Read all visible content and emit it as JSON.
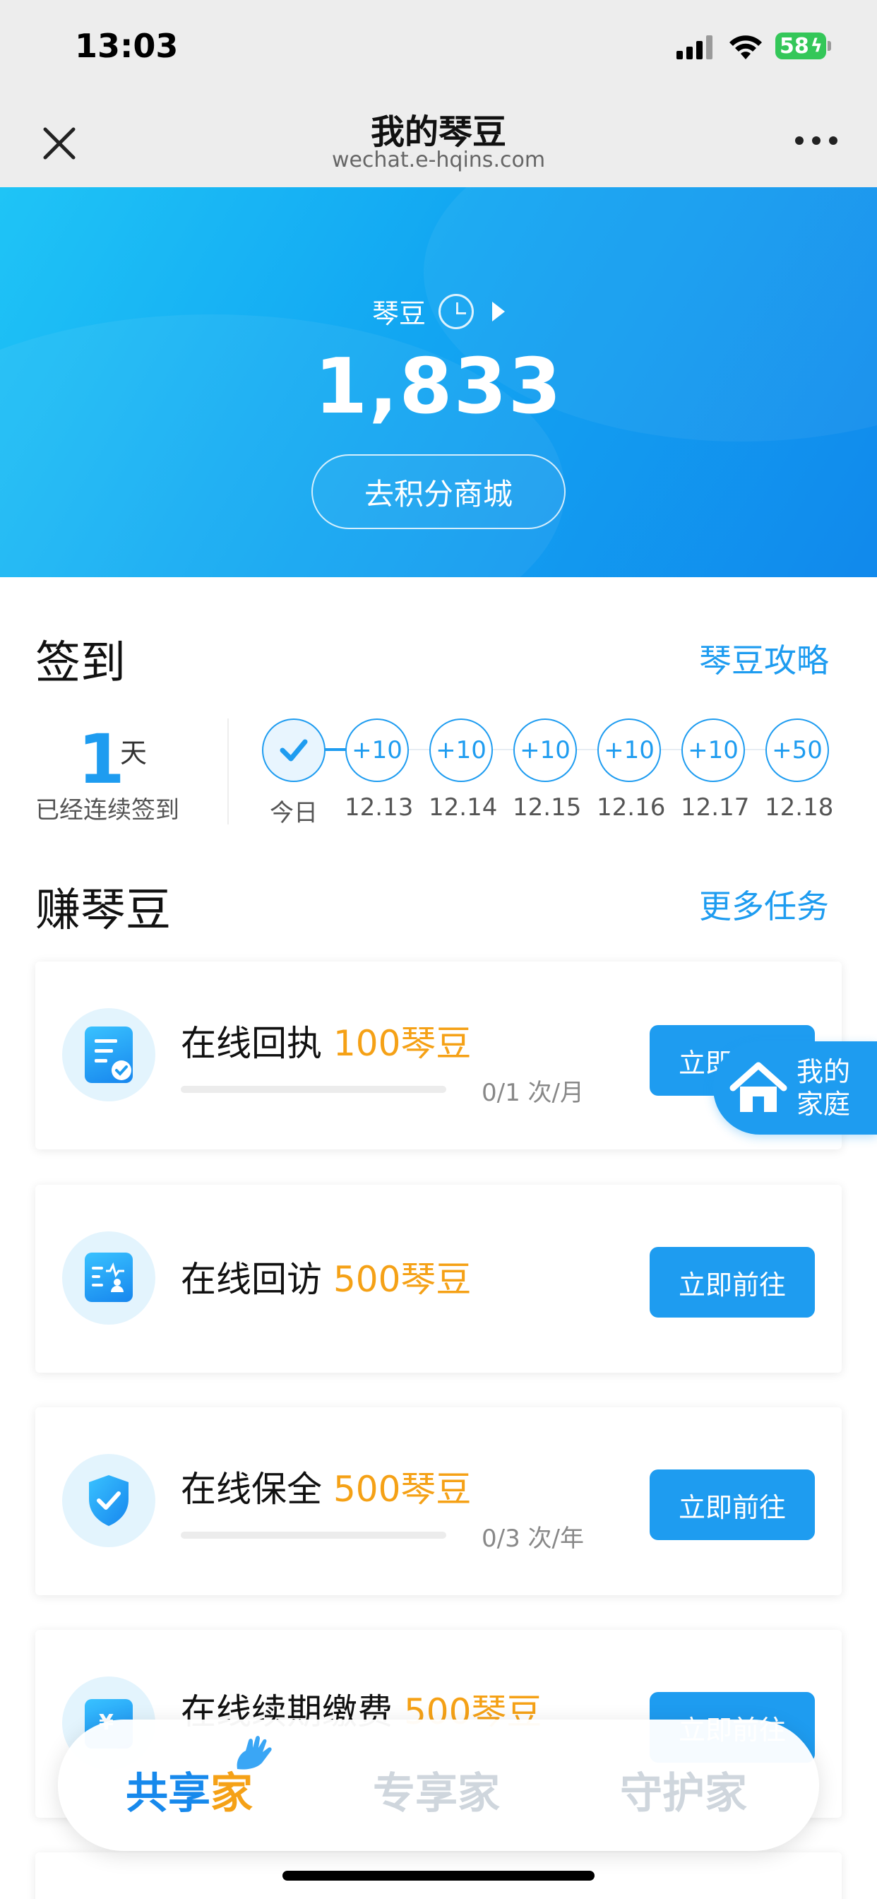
{
  "status_bar": {
    "time": "13:03",
    "battery": "58"
  },
  "nav": {
    "title": "我的琴豆",
    "subtitle": "wechat.e-hqins.com"
  },
  "hero": {
    "label": "琴豆",
    "points": "1,833",
    "mall_button": "去积分商城"
  },
  "checkin": {
    "title": "签到",
    "guide_link": "琴豆攻略",
    "streak_days": "1",
    "streak_unit": "天",
    "streak_label": "已经连续签到",
    "days": [
      {
        "reward": "",
        "label": "今日",
        "checked": true
      },
      {
        "reward": "+10",
        "label": "12.13"
      },
      {
        "reward": "+10",
        "label": "12.14"
      },
      {
        "reward": "+10",
        "label": "12.15"
      },
      {
        "reward": "+10",
        "label": "12.16"
      },
      {
        "reward": "+10",
        "label": "12.17"
      },
      {
        "reward": "+50",
        "label": "12.18"
      }
    ]
  },
  "earn": {
    "title": "赚琴豆",
    "more_link": "更多任务",
    "tasks": [
      {
        "title": "在线回执",
        "reward": "100琴豆",
        "progress": "0/1 次/月",
        "progress_fraction": 0,
        "button": "立即前往",
        "icon": "receipt-icon"
      },
      {
        "title": "在线回访",
        "reward": "500琴豆",
        "button": "立即前往",
        "icon": "revisit-icon"
      },
      {
        "title": "在线保全",
        "reward": "500琴豆",
        "progress": "0/3 次/年",
        "progress_fraction": 0,
        "button": "立即前往",
        "icon": "shield-check-icon"
      },
      {
        "title": "在线续期缴费",
        "reward": "500琴豆",
        "button": "立即前往",
        "icon": "payment-icon"
      }
    ]
  },
  "family_fab": {
    "line1": "我的",
    "line2": "家庭"
  },
  "tabbar": {
    "tab1_part1": "共享",
    "tab1_part2": "家",
    "tab2": "专享家",
    "tab3": "守护家"
  },
  "colors": {
    "accent": "#1e9cf0",
    "reward": "#f5a116"
  }
}
